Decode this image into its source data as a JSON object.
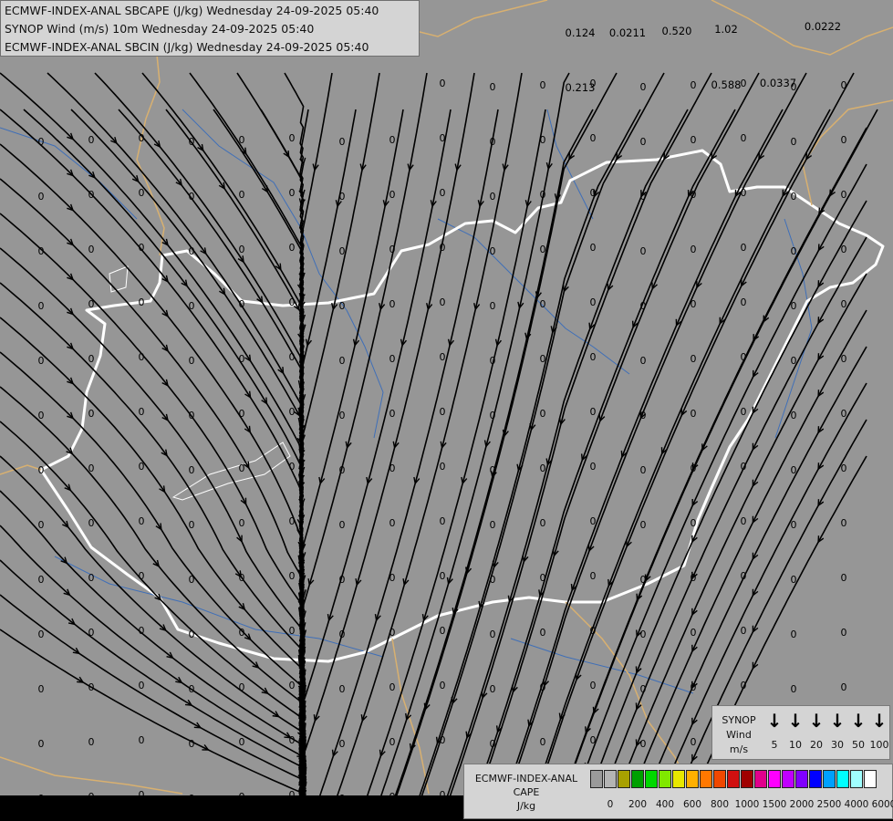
{
  "header": {
    "line1": "ECMWF-INDEX-ANAL SBCAPE (J/kg) Wednesday 24-09-2025 05:40",
    "line2": "SYNOP Wind (m/s) 10m Wednesday 24-09-2025 05:40",
    "line3": "ECMWF-INDEX-ANAL SBCIN (J/kg) Wednesday 24-09-2025 05:40"
  },
  "colors": {
    "background": "#969696",
    "streamline": "#000000",
    "border_country": "#ffffff",
    "border_neighbor": "#d8b070",
    "river": "#3f6fb8",
    "value_text": "#000000"
  },
  "value_labels": [
    {
      "text": "0.124"
    },
    {
      "text": "0.0211"
    },
    {
      "text": "0.520"
    },
    {
      "text": "1.02"
    },
    {
      "text": "0.0222"
    },
    {
      "text": "0.213"
    },
    {
      "text": "0.588"
    },
    {
      "text": "0.0337"
    }
  ],
  "synop_legend": {
    "title_line1": "SYNOP",
    "title_line2": "Wind",
    "title_line3": "m/s",
    "speeds": [
      "5",
      "10",
      "20",
      "30",
      "50",
      "100"
    ],
    "arrow_icon": "wind-arrow-down"
  },
  "cape_legend": {
    "title_line1": "ECMWF-INDEX-ANAL",
    "title_line2": "CAPE",
    "title_line3": "J/kg",
    "ticks": [
      "0",
      "200",
      "400",
      "600",
      "800",
      "1000",
      "1500",
      "2000",
      "2500",
      "4000",
      "6000"
    ],
    "swatch_colors": [
      "#9a9a9a",
      "#b4b4b4",
      "#a8a000",
      "#00a000",
      "#00d800",
      "#80e800",
      "#e8e800",
      "#ffb000",
      "#ff7800",
      "#f04800",
      "#d01010",
      "#a00000",
      "#e0008c",
      "#ff00ff",
      "#c000ff",
      "#8000ff",
      "#0000ff",
      "#00a0ff",
      "#00ffff",
      "#a0ffff",
      "#ffffff"
    ]
  }
}
